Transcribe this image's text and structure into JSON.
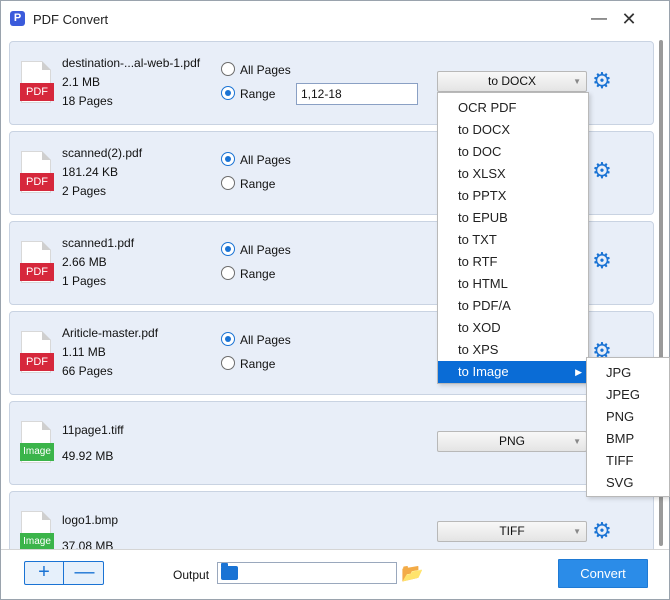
{
  "window": {
    "title": "PDF Convert",
    "logo_letter": "P",
    "minimize_glyph": "—",
    "close_glyph": "✕"
  },
  "files": [
    {
      "name": "destination-...al-web-1.pdf",
      "size": "2.1 MB",
      "pages": "18 Pages",
      "type_badge": "PDF",
      "page_mode": "Range",
      "all_pages_label": "All Pages",
      "range_label": "Range",
      "range_value": "1,12-18",
      "format": "to DOCX"
    },
    {
      "name": "scanned(2).pdf",
      "size": "181.24 KB",
      "pages": "2 Pages",
      "type_badge": "PDF",
      "page_mode": "All Pages",
      "all_pages_label": "All Pages",
      "range_label": "Range"
    },
    {
      "name": "scanned1.pdf",
      "size": "2.66 MB",
      "pages": "1 Pages",
      "type_badge": "PDF",
      "page_mode": "All Pages",
      "all_pages_label": "All Pages",
      "range_label": "Range"
    },
    {
      "name": "Ariticle-master.pdf",
      "size": "1.11 MB",
      "pages": "66 Pages",
      "type_badge": "PDF",
      "page_mode": "All Pages",
      "all_pages_label": "All Pages",
      "range_label": "Range"
    },
    {
      "name": "11page1.tiff",
      "size": "49.92 MB",
      "type_badge": "Image",
      "format": "PNG"
    },
    {
      "name": "logo1.bmp",
      "size": "37.08 MB",
      "type_badge": "Image",
      "format": "TIFF"
    }
  ],
  "format_dropdown": {
    "items": [
      "OCR PDF",
      "to DOCX",
      "to DOC",
      "to XLSX",
      "to PPTX",
      "to EPUB",
      "to TXT",
      "to RTF",
      "to HTML",
      "to PDF/A",
      "to XOD",
      "to XPS",
      "to Image"
    ],
    "highlighted": "to Image",
    "submenu_arrow": "▶"
  },
  "image_submenu": {
    "items": [
      "JPG",
      "JPEG",
      "PNG",
      "BMP",
      "TIFF",
      "SVG"
    ]
  },
  "icons": {
    "gear": "gear-icon",
    "dropdown_arrow": "▼",
    "gear_glyph": "⚙"
  },
  "bottom": {
    "add_glyph": "+",
    "remove_glyph": "—",
    "output_label": "Output",
    "output_path": "",
    "browse_glyph": "📂",
    "convert_label": "Convert"
  },
  "colors": {
    "accent": "#1a73d4",
    "selected": "#0a6cd6",
    "card_bg": "#e8eef8",
    "pdf_badge": "#d6283c",
    "image_badge": "#3bb44a"
  }
}
